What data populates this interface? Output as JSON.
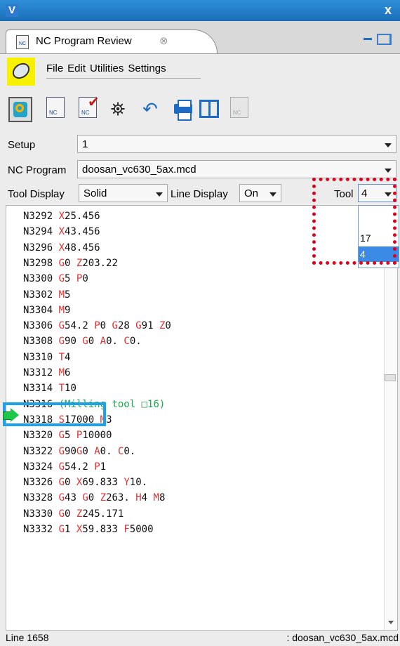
{
  "window": {
    "logo": "V",
    "close": "x"
  },
  "tab": {
    "title": "NC Program Review",
    "close": "⊗"
  },
  "menu": {
    "items": [
      "File",
      "Edit",
      "Utilities",
      "Settings"
    ]
  },
  "toolbar": {
    "icons": [
      "verify-icon",
      "nc-file-icon",
      "nc-check-icon",
      "binoculars-icon",
      "undo-icon",
      "printer-icon",
      "split-view-icon",
      "nc-disabled-icon"
    ]
  },
  "fields": {
    "setup": {
      "label": "Setup",
      "value": "1"
    },
    "nc_program": {
      "label": "NC Program",
      "value": "doosan_vc630_5ax.mcd"
    },
    "tool_display": {
      "label": "Tool Display",
      "value": "Solid"
    },
    "line_display": {
      "label": "Line Display",
      "value": "On"
    },
    "tool": {
      "label": "Tool",
      "value": "4",
      "options": [
        "",
        "17",
        "4"
      ]
    }
  },
  "code_lines": [
    "N3292 X25.456",
    "N3294 X43.456",
    "N3296 X48.456",
    "N3298 G0 Z203.22",
    "N3300 G5 P0",
    "N3302 M5",
    "N3304 M9",
    "N3306 G54.2 P0 G28 G91 Z0",
    "N3308 G90 G0 A0. C0.",
    "N3310 T4",
    "N3312 M6",
    "N3314 T10",
    "N3316 (Milling tool □16)",
    "N3318 S17000 M3",
    "N3320 G5 P10000",
    "N3322 G90G0 A0. C0.",
    "N3324 G54.2 P1",
    "N3326 G0 X69.833 Y10.",
    "N3328 G43 G0 Z263. H4 M8",
    "N3330 G0 Z245.171",
    "N3332 G1 X59.833 F5000"
  ],
  "current_line": "N3312 M6",
  "status": {
    "left": "Line 1658",
    "right": ": doosan_vc630_5ax.mcd"
  },
  "colors": {
    "titlebar": "#1a6fb8",
    "highlight_yellow": "#f7f000",
    "nc_address": "#e03030",
    "comment": "#1aa84a",
    "annotation_red": "#e3001b",
    "annotation_blue": "#1da1e8",
    "selected_option": "#3b8ae6"
  }
}
